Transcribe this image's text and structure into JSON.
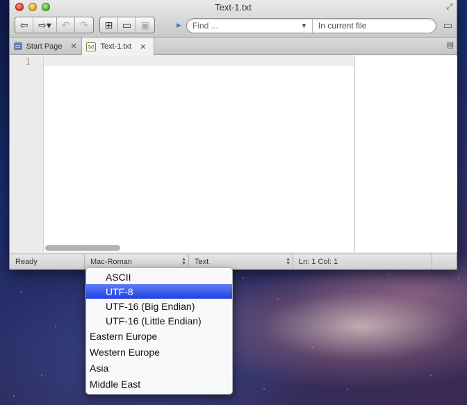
{
  "window": {
    "title": "Text-1.txt"
  },
  "toolbar": {
    "back_icon": "arrow-left-icon",
    "forward_icon": "arrow-right-icon",
    "undo_icon": "undo-icon",
    "redo_icon": "redo-icon",
    "new_icon": "new-file-icon",
    "open_icon": "folder-icon",
    "save_icon": "save-icon"
  },
  "search": {
    "placeholder": "Find ...",
    "scope": "In current file"
  },
  "tabs": [
    {
      "label": "Start Page",
      "icon": "start-page-icon",
      "active": false
    },
    {
      "label": "Text-1.txt",
      "icon": "txt-file-icon",
      "active": true
    }
  ],
  "editor": {
    "line_numbers": [
      "1"
    ],
    "content": ""
  },
  "statusbar": {
    "state": "Ready",
    "encoding": "Mac-Roman",
    "language": "Text",
    "position": "Ln: 1 Col: 1"
  },
  "encoding_menu": {
    "items": [
      {
        "label": "ASCII",
        "type": "option",
        "selected": false
      },
      {
        "label": "UTF-8",
        "type": "option",
        "selected": true
      },
      {
        "label": "UTF-16 (Big Endian)",
        "type": "option",
        "selected": false
      },
      {
        "label": "UTF-16 (Little Endian)",
        "type": "option",
        "selected": false
      },
      {
        "label": "Eastern Europe",
        "type": "group",
        "selected": false
      },
      {
        "label": "Western Europe",
        "type": "group",
        "selected": false
      },
      {
        "label": "Asia",
        "type": "group",
        "selected": false
      },
      {
        "label": "Middle East",
        "type": "group",
        "selected": false
      }
    ]
  },
  "colors": {
    "selection": "#2f4df0",
    "accent": "#3b7fd0"
  }
}
